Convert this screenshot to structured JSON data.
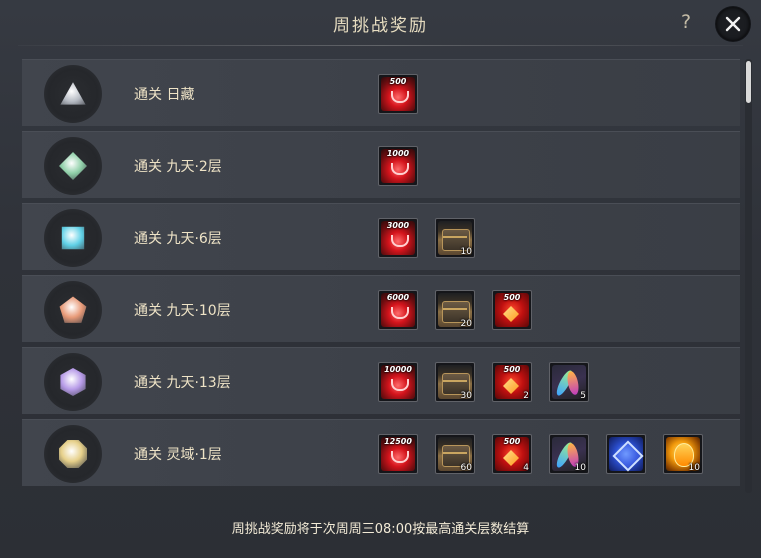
{
  "window": {
    "title": "周挑战奖励",
    "help_label": "?",
    "close_label": "close"
  },
  "rows": [
    {
      "label": "通关 日藏",
      "emblem": "grey-triangle-emblem",
      "emblem_color": "#b7bcc4",
      "rewards": [
        {
          "type": "coin",
          "top": "500",
          "count": ""
        }
      ]
    },
    {
      "label": "通关 九天·2层",
      "emblem": "green-diamond-emblem",
      "emblem_color": "#8fcfa8",
      "rewards": [
        {
          "type": "coin",
          "top": "1000",
          "count": ""
        }
      ]
    },
    {
      "label": "通关 九天·6层",
      "emblem": "cyan-square-emblem",
      "emblem_color": "#5fd0e6",
      "rewards": [
        {
          "type": "coin",
          "top": "3000",
          "count": ""
        },
        {
          "type": "chest",
          "top": "",
          "count": "10"
        }
      ]
    },
    {
      "label": "通关 九天·10层",
      "emblem": "orange-pentagon-emblem",
      "emblem_color": "#e89a78",
      "rewards": [
        {
          "type": "coin",
          "top": "6000",
          "count": ""
        },
        {
          "type": "chest",
          "top": "",
          "count": "20"
        },
        {
          "type": "red",
          "top": "500",
          "count": ""
        }
      ]
    },
    {
      "label": "通关 九天·13层",
      "emblem": "purple-hexagon-emblem",
      "emblem_color": "#b79be8",
      "rewards": [
        {
          "type": "coin",
          "top": "10000",
          "count": ""
        },
        {
          "type": "chest",
          "top": "",
          "count": "30"
        },
        {
          "type": "red",
          "top": "500",
          "count": "2"
        },
        {
          "type": "feather",
          "top": "",
          "count": "5"
        }
      ]
    },
    {
      "label": "通关 灵域·1层",
      "emblem": "gold-octagon-emblem",
      "emblem_color": "#e6d08a",
      "rewards": [
        {
          "type": "coin",
          "top": "12500",
          "count": ""
        },
        {
          "type": "chest",
          "top": "",
          "count": "60"
        },
        {
          "type": "red",
          "top": "500",
          "count": "4"
        },
        {
          "type": "feather",
          "top": "",
          "count": "10"
        },
        {
          "type": "cube",
          "top": "",
          "count": ""
        },
        {
          "type": "gem",
          "top": "",
          "count": "10"
        }
      ]
    }
  ],
  "footer": {
    "note": "周挑战奖励将于次周周三08:00按最高通关层数结算"
  }
}
